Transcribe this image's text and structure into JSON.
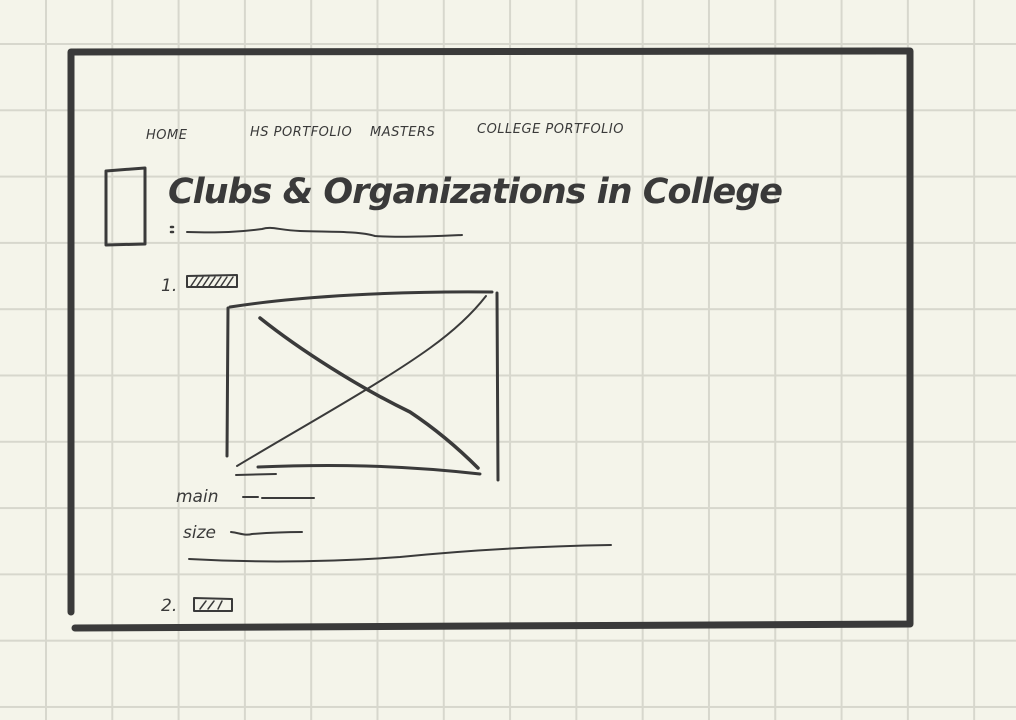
{
  "nav": {
    "items": [
      {
        "label": "HOME"
      },
      {
        "label": "HS PORTFOLIO"
      },
      {
        "label": "MASTERS"
      },
      {
        "label": "COLLEGE PORTFOLIO"
      }
    ]
  },
  "page": {
    "title": "Clubs & Organizations in College"
  },
  "entries": [
    {
      "number": "1.",
      "fields": [
        {
          "label": "main"
        },
        {
          "label": "size"
        }
      ]
    },
    {
      "number": "2."
    }
  ]
}
